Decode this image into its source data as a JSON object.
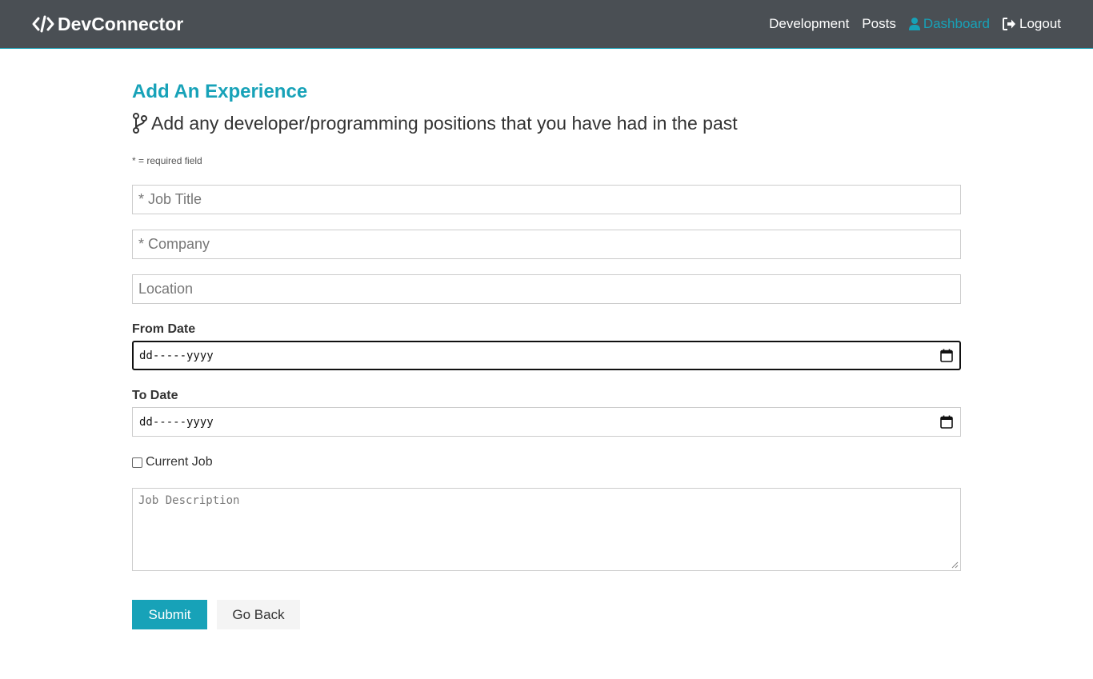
{
  "navbar": {
    "brand": "DevConnector",
    "links": [
      {
        "label": "Development"
      },
      {
        "label": "Posts"
      },
      {
        "label": "Dashboard",
        "icon": "user-icon",
        "active": true
      },
      {
        "label": "Logout",
        "icon": "sign-out-icon"
      }
    ]
  },
  "page": {
    "heading": "Add An Experience",
    "lead": "Add any developer/programming positions that you have had in the past",
    "required_note": "* = required field"
  },
  "form": {
    "job_title_placeholder": "* Job Title",
    "company_placeholder": "* Company",
    "location_placeholder": "Location",
    "from_date_label": "From Date",
    "from_date_value": "dd-----yyyy",
    "to_date_label": "To Date",
    "to_date_value": "dd-----yyyy",
    "current_job_label": "Current Job",
    "current_job_checked": false,
    "description_placeholder": "Job Description",
    "submit_label": "Submit",
    "go_back_label": "Go Back"
  },
  "colors": {
    "navbar_bg": "#4a4f54",
    "accent": "#17a2b8",
    "light_button": "#f4f4f4"
  }
}
